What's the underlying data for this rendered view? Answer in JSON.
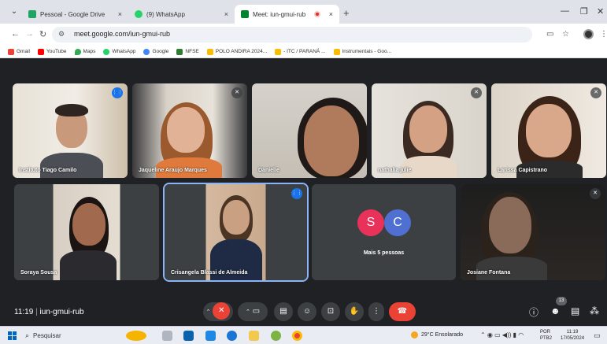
{
  "browser": {
    "tabs": [
      {
        "title": "Pessoal - Google Drive",
        "color": "#1fa463"
      },
      {
        "title": "(9) WhatsApp",
        "color": "#25d366"
      },
      {
        "title": "Meet: iun-gmui-rub",
        "color": "#00832d"
      }
    ],
    "tab_close": "×",
    "new_tab": "+",
    "url": "meet.google.com/iun-gmui-rub"
  },
  "bookmarks": [
    {
      "label": "Gmail",
      "color": "#ea4335"
    },
    {
      "label": "YouTube",
      "color": "#ff0000"
    },
    {
      "label": "Maps",
      "color": "#34a853"
    },
    {
      "label": "WhatsApp",
      "color": "#25d366"
    },
    {
      "label": "Google",
      "color": "#4285f4"
    },
    {
      "label": "NFSE",
      "color": "#2e7d32"
    },
    {
      "label": "POLO ANDIRA 2024...",
      "color": "#fbbc04"
    },
    {
      "label": "- ITC / PARANÁ ...",
      "color": "#fbbc04"
    },
    {
      "label": "Instrumentais - Goo...",
      "color": "#fbbc04"
    }
  ],
  "participants": [
    {
      "name": "Instituto Tiago Camilo",
      "status": "speaking"
    },
    {
      "name": "Jaqueline Araujo Marques",
      "status": "muted"
    },
    {
      "name": "Danielle",
      "status": ""
    },
    {
      "name": "nathalia julie",
      "status": "muted"
    },
    {
      "name": "Larissa Capistrano",
      "status": "muted"
    },
    {
      "name": "Soraya Sousa",
      "status": ""
    },
    {
      "name": "Crisangela Blassi de Almeida",
      "status": "speaking"
    },
    {
      "name": "Josiane Fontana",
      "status": "muted"
    }
  ],
  "overflow_tile": {
    "avatars": [
      {
        "letter": "S",
        "color": "#e8325a"
      },
      {
        "letter": "C",
        "color": "#4f6fd1"
      }
    ],
    "label": "Mais 5 pessoas"
  },
  "meeting": {
    "time": "11:19",
    "code": "iun-gmui-rub",
    "participant_count": "13"
  },
  "taskbar": {
    "search_placeholder": "Pesquisar",
    "weather": "29°C  Ensolarado",
    "lang_top": "POR",
    "lang_bottom": "PTB2",
    "time": "11:19",
    "date": "17/05/2024"
  }
}
